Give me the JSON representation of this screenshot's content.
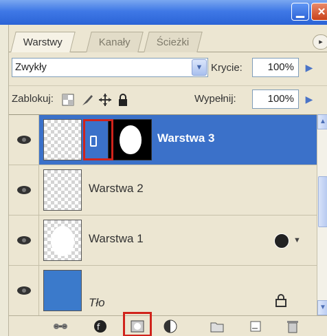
{
  "tabs": [
    {
      "label": "Warstwy",
      "active": true
    },
    {
      "label": "Kanały",
      "active": false
    },
    {
      "label": "Ścieżki",
      "active": false
    }
  ],
  "blend": {
    "mode": "Zwykły",
    "opacity_label": "Krycie:",
    "opacity_value": "100%"
  },
  "lock": {
    "label": "Zablokuj:",
    "fill_label": "Wypełnij:",
    "fill_value": "100%"
  },
  "layers": [
    {
      "name": "Warstwa 3",
      "selected": true,
      "has_mask": true,
      "visible": true
    },
    {
      "name": "Warstwa 2",
      "selected": false,
      "visible": true
    },
    {
      "name": "Warstwa 1",
      "selected": false,
      "visible": true,
      "has_effects": true
    },
    {
      "name": "Tło",
      "selected": false,
      "visible": true,
      "locked": true,
      "fill_color": "#3b7acb"
    }
  ],
  "colors": {
    "selection": "#3b71c9",
    "highlight": "#d0231b",
    "titlebar": "#2b64d6"
  },
  "bottom_toolbar_icons": [
    "link-layers-icon",
    "layer-style-icon",
    "add-mask-icon",
    "adjustment-layer-icon",
    "group-folder-icon",
    "new-layer-icon",
    "trash-icon"
  ]
}
